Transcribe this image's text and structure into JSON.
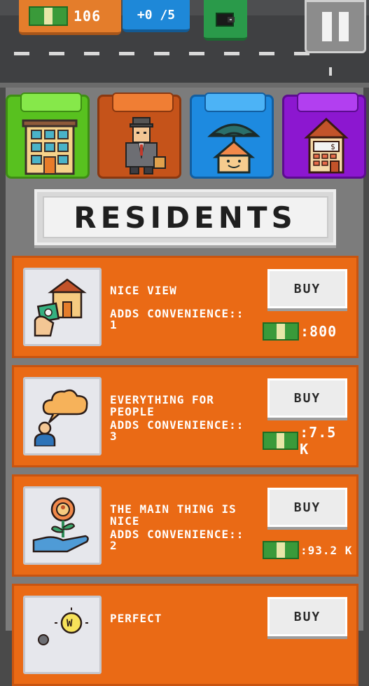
{
  "hud": {
    "money": "106",
    "rate": "+0 /5",
    "icons": {
      "money": "cash-icon",
      "wallet": "wallet-icon",
      "pause": "pause-icon"
    }
  },
  "tabs": [
    {
      "name": "buildings",
      "icon": "apartment-building-icon",
      "color": "#58c11f"
    },
    {
      "name": "residents",
      "icon": "businessman-icon",
      "color": "#c5531a"
    },
    {
      "name": "leisure",
      "icon": "house-umbrella-icon",
      "color": "#1d8ae0"
    },
    {
      "name": "shop",
      "icon": "price-tag-house-icon",
      "color": "#8c17d0"
    }
  ],
  "section_title": "RESIDENTS",
  "items": [
    {
      "name": "NICE VIEW",
      "desc": "ADDS CONVENIENCE:: 1",
      "buy": "BUY",
      "price": ":800",
      "icon": "money-house-hand-icon"
    },
    {
      "name": "EVERYTHING FOR PEOPLE",
      "desc": "ADDS CONVENIENCE:: 3",
      "buy": "BUY",
      "price": ":7.5 K",
      "icon": "person-cloud-icon"
    },
    {
      "name": "THE MAIN THING IS NICE",
      "desc": "ADDS CONVENIENCE:: 2",
      "buy": "BUY",
      "price": ":93.2 K",
      "icon": "hand-flower-person-icon"
    },
    {
      "name": "PERFECT",
      "desc": "",
      "buy": "BUY",
      "price": "",
      "icon": "lightbulb-coin-icon"
    }
  ],
  "colors": {
    "card": "#ea6a15",
    "panel": "#7c7c7c",
    "road": "#3f4042"
  }
}
